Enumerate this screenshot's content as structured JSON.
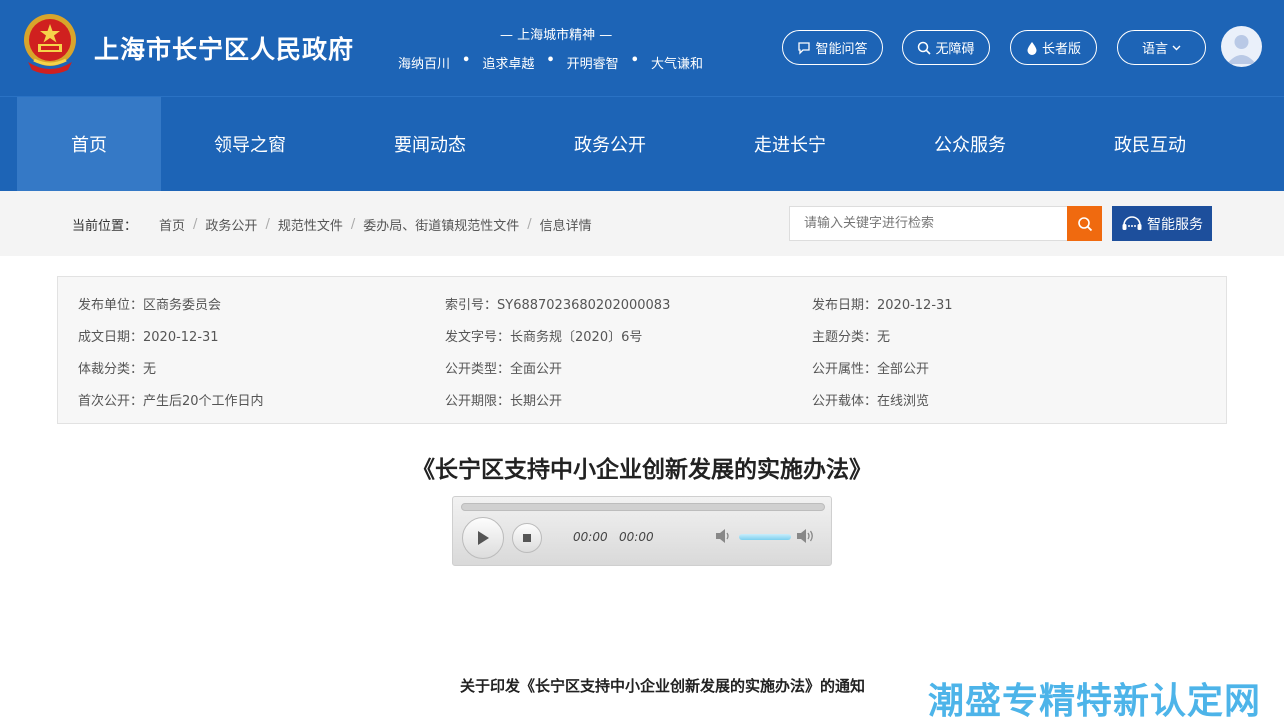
{
  "header": {
    "site_title": "上海市长宁区人民政府",
    "spirit_title": "— 上海城市精神 —",
    "spirit_items": [
      "海纳百川",
      "追求卓越",
      "开明睿智",
      "大气谦和"
    ],
    "buttons": {
      "smart_qa": "智能问答",
      "accessibility": "无障碍",
      "elderly": "长者版",
      "language": "语言"
    }
  },
  "nav": {
    "items": [
      "首页",
      "领导之窗",
      "要闻动态",
      "政务公开",
      "走进长宁",
      "公众服务",
      "政民互动"
    ],
    "active_index": 0
  },
  "breadcrumb": {
    "label": "当前位置：",
    "items": [
      "首页",
      "政务公开",
      "规范性文件",
      "委办局、街道镇规范性文件",
      "信息详情"
    ]
  },
  "search": {
    "placeholder": "请输入关键字进行检索",
    "smart_service": "智能服务"
  },
  "info": {
    "publisher": "发布单位：区商务委员会",
    "index_no": "索引号：SY6887023680202000083",
    "publish_date": "发布日期：2020-12-31",
    "formed_date": "成文日期：2020-12-31",
    "doc_no": "发文字号：长商务规〔2020〕6号",
    "topic": "主题分类：无",
    "genre": "体裁分类：无",
    "open_type": "公开类型：全面公开",
    "open_attr": "公开属性：全部公开",
    "first_open": "首次公开：产生后20个工作日内",
    "open_period": "公开期限：长期公开",
    "open_carrier": "公开载体：在线浏览"
  },
  "document": {
    "title": "《长宁区支持中小企业创新发展的实施办法》",
    "notice": "关于印发《长宁区支持中小企业创新发展的实施办法》的通知"
  },
  "audio": {
    "current_time": "00:00",
    "duration": "00:00"
  },
  "watermark": "潮盛专精特新认定网",
  "colors": {
    "header_bg": "#1d64b6",
    "nav_active": "#3579c6",
    "search_btn": "#f06a0f",
    "smart_btn": "#1d4f9c",
    "watermark": "#2fa7e6"
  }
}
